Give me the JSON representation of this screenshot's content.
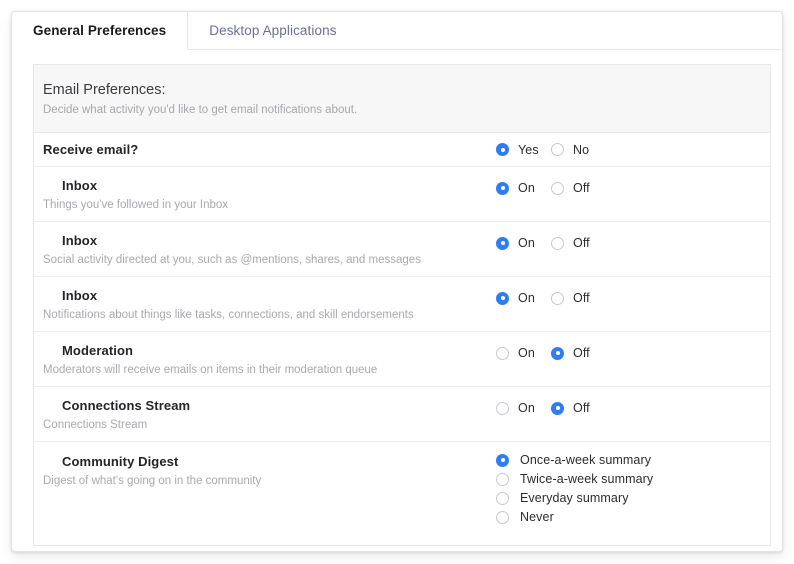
{
  "tabs": [
    {
      "label": "General Preferences",
      "active": true
    },
    {
      "label": "Desktop Applications",
      "active": false
    }
  ],
  "panel": {
    "title": "Email Preferences:",
    "subtitle": "Decide what activity you'd like to get email notifications about."
  },
  "receive_email": {
    "label": "Receive email?",
    "options": [
      {
        "label": "Yes",
        "checked": true
      },
      {
        "label": "No",
        "checked": false
      }
    ]
  },
  "settings": [
    {
      "label": "Inbox",
      "desc": "Things you've followed in your Inbox",
      "options": [
        {
          "label": "On",
          "checked": true
        },
        {
          "label": "Off",
          "checked": false
        }
      ]
    },
    {
      "label": "Inbox",
      "desc": "Social activity directed at you, such as @mentions, shares, and messages",
      "options": [
        {
          "label": "On",
          "checked": true
        },
        {
          "label": "Off",
          "checked": false
        }
      ]
    },
    {
      "label": "Inbox",
      "desc": "Notifications about things like tasks, connections, and skill endorsements",
      "options": [
        {
          "label": "On",
          "checked": true
        },
        {
          "label": "Off",
          "checked": false
        }
      ]
    },
    {
      "label": "Moderation",
      "desc": "Moderators will receive emails on items in their moderation queue",
      "options": [
        {
          "label": "On",
          "checked": false
        },
        {
          "label": "Off",
          "checked": true
        }
      ]
    },
    {
      "label": "Connections Stream",
      "desc": "Connections Stream",
      "options": [
        {
          "label": "On",
          "checked": false
        },
        {
          "label": "Off",
          "checked": true
        }
      ]
    }
  ],
  "digest": {
    "label": "Community Digest",
    "desc": "Digest of what's going on in the community",
    "options": [
      {
        "label": "Once-a-week summary",
        "checked": true
      },
      {
        "label": "Twice-a-week summary",
        "checked": false
      },
      {
        "label": "Everyday summary",
        "checked": false
      },
      {
        "label": "Never",
        "checked": false
      }
    ]
  },
  "colors": {
    "accent": "#2f7df6",
    "tab_active_text": "#1a1a1c",
    "tab_inactive_text": "#6e6e9c",
    "header_bg": "#f7f7f8",
    "muted_text": "#a9a9af"
  }
}
